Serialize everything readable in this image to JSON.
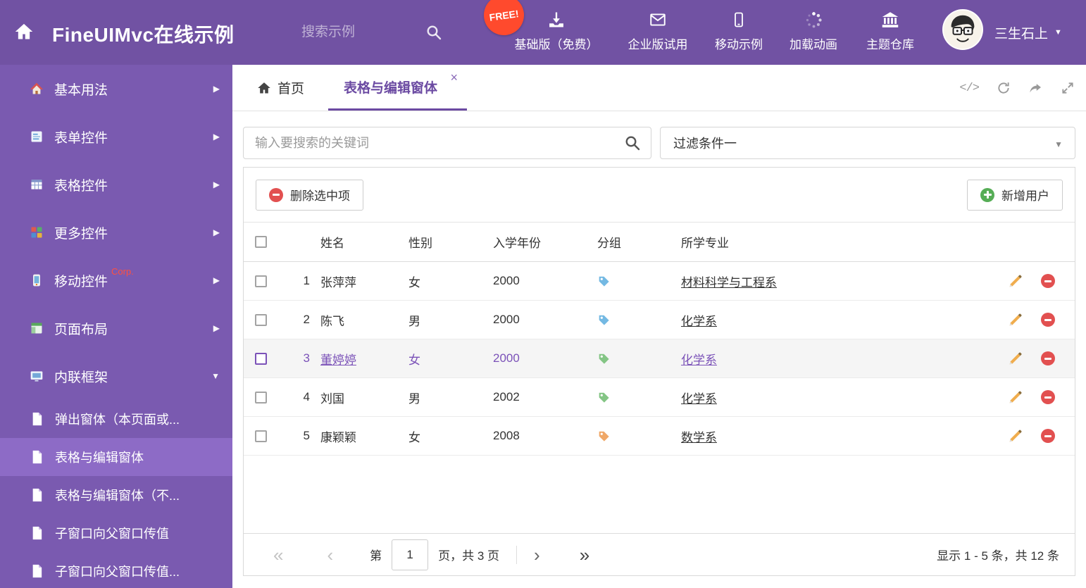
{
  "icons": {
    "chevron_right": "▶",
    "chevron_down": "▼",
    "caret_down": "▼",
    "close": "×",
    "code": "</>",
    "pager_first": "«",
    "pager_prev": "‹",
    "pager_next": "›",
    "pager_last": "»"
  },
  "colors": {
    "accent": "#7152a3",
    "sidebar": "#7a5ab0",
    "selected_row_text": "#7b52b8",
    "danger": "#e25050",
    "success": "#56ad56"
  },
  "header": {
    "title": "FineUIMvc在线示例",
    "search_placeholder": "搜索示例",
    "free_badge": "FREE!",
    "nav_items": [
      {
        "label": "基础版（免费）"
      },
      {
        "label": "企业版试用"
      },
      {
        "label": "移动示例"
      },
      {
        "label": "加载动画"
      },
      {
        "label": "主题仓库"
      }
    ],
    "username": "三生石上"
  },
  "sidebar": {
    "items": [
      {
        "label": "基本用法"
      },
      {
        "label": "表单控件"
      },
      {
        "label": "表格控件"
      },
      {
        "label": "更多控件"
      },
      {
        "label": "移动控件",
        "badge": "Corp."
      },
      {
        "label": "页面布局"
      },
      {
        "label": "内联框架"
      }
    ],
    "subitems": [
      {
        "label": "弹出窗体（本页面或..."
      },
      {
        "label": "表格与编辑窗体"
      },
      {
        "label": "表格与编辑窗体（不..."
      },
      {
        "label": "子窗口向父窗口传值"
      },
      {
        "label": "子窗口向父窗口传值..."
      }
    ]
  },
  "tabs": {
    "home_label": "首页",
    "active_label": "表格与编辑窗体"
  },
  "filters": {
    "search_placeholder": "输入要搜索的关键词",
    "filter_value": "过滤条件一"
  },
  "toolbar": {
    "delete_label": "删除选中项",
    "add_label": "新增用户"
  },
  "table": {
    "columns": [
      "姓名",
      "性别",
      "入学年份",
      "分组",
      "所学专业"
    ],
    "rows": [
      {
        "num": "1",
        "name": "张萍萍",
        "gender": "女",
        "year": "2000",
        "tag_color": "#74b9e3",
        "major": "材料科学与工程系"
      },
      {
        "num": "2",
        "name": "陈飞",
        "gender": "男",
        "year": "2000",
        "tag_color": "#74b9e3",
        "major": "化学系"
      },
      {
        "num": "3",
        "name": "董婷婷",
        "gender": "女",
        "year": "2000",
        "tag_color": "#84c585",
        "major": "化学系"
      },
      {
        "num": "4",
        "name": "刘国",
        "gender": "男",
        "year": "2002",
        "tag_color": "#84c585",
        "major": "化学系"
      },
      {
        "num": "5",
        "name": "康颖颖",
        "gender": "女",
        "year": "2008",
        "tag_color": "#f0a868",
        "major": "数学系"
      }
    ]
  },
  "pagination": {
    "page_prefix": "第",
    "page_value": "1",
    "page_suffix": "页，共 3 页",
    "summary": "显示 1 - 5 条，共 12 条"
  }
}
